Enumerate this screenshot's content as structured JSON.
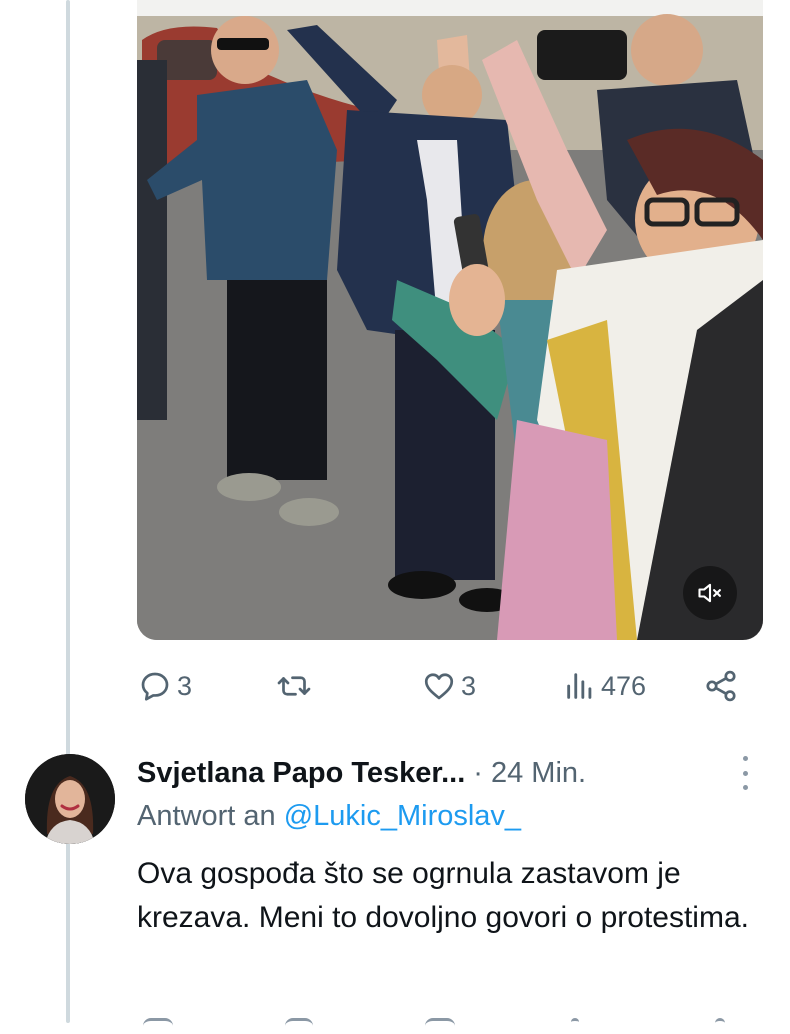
{
  "colors": {
    "text_primary": "#0f1419",
    "text_secondary": "#536471",
    "link": "#1d9bf0",
    "thread_line": "#cfd9de"
  },
  "video": {
    "mute_icon": "volume-muted-icon"
  },
  "tweet_actions": {
    "replies": "3",
    "retweets": "",
    "likes": "3",
    "views": "476",
    "icons": [
      "reply-icon",
      "retweet-icon",
      "like-icon",
      "views-icon",
      "share-icon"
    ]
  },
  "reply": {
    "author_name": "Svjetlana Papo Tesker...",
    "separator": "·",
    "time": "24 Min.",
    "reply_prefix": "Antwort an",
    "reply_handle": "@Lukic_Miroslav_",
    "text": "Ova gospođa što se ogrnula zastavom je krezava. Meni to dovoljno govori o protestima."
  }
}
